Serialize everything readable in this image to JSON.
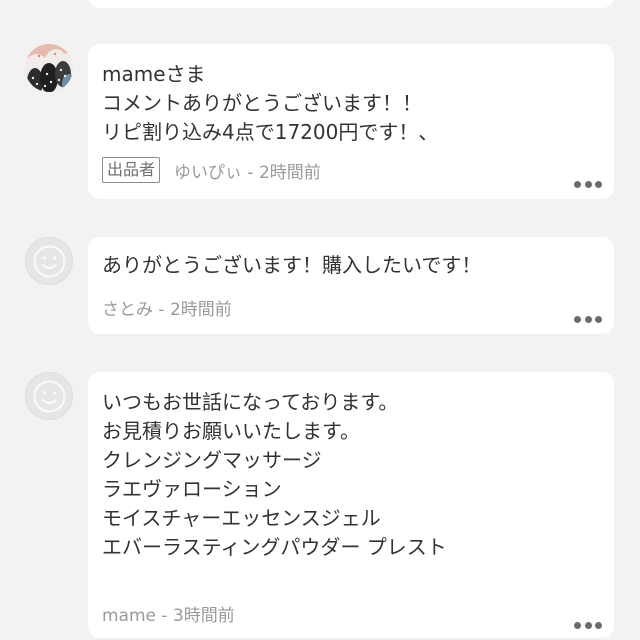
{
  "comments": [
    {
      "body": "mameさま\nコメントありがとうございます！！\nリピ割り込み4点で17200円です！、",
      "badge": "出品者",
      "meta": "ゆいぴぃ - 2時間前"
    },
    {
      "body": "ありがとうございます！購入したいです！",
      "meta": "さとみ - 2時間前"
    },
    {
      "body": "いつもお世話になっております。\nお見積りお願いいたします。\nクレンジングマッサージ\nラエヴァローション\nモイスチャーエッセンスジェル\nエバーラスティングパウダー プレスト",
      "meta": "mame - 3時間前"
    }
  ],
  "icons": {
    "more": "more-horizontal-icon",
    "avatar_default": "face-icon"
  },
  "colors": {
    "background": "#f2f2f2",
    "card": "#ffffff",
    "text": "#333333",
    "meta": "#9a9a9a"
  }
}
